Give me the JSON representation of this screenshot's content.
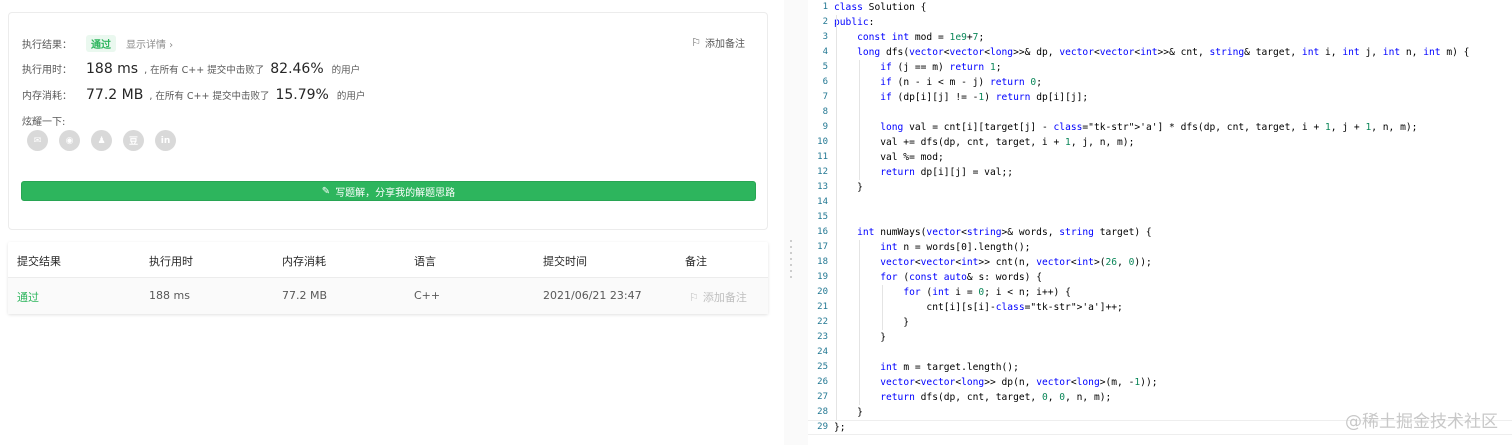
{
  "result": {
    "label": "执行结果：",
    "status": "通过",
    "details_link": "显示详情 ›",
    "add_note": "添加备注",
    "runtime_label": "执行用时：",
    "runtime_value": "188 ms",
    "runtime_text": ", 在所有 C++ 提交中击败了",
    "runtime_pct": "82.46%",
    "runtime_suffix": "的用户",
    "memory_label": "内存消耗：",
    "memory_value": "77.2 MB",
    "memory_text": ", 在所有 C++ 提交中击败了",
    "memory_pct": "15.79%",
    "memory_suffix": "的用户",
    "share_label": "炫耀一下:",
    "share_icons": [
      "wechat-icon",
      "weibo-icon",
      "qq-icon",
      "douban-icon",
      "linkedin-icon"
    ],
    "share_glyphs": [
      "✉",
      "◉",
      "♟",
      "豆",
      "in"
    ],
    "write_button": "写题解，分享我的解题思路",
    "status_color": "#2db55d"
  },
  "submissions": {
    "headers": [
      "提交结果",
      "执行用时",
      "内存消耗",
      "语言",
      "提交时间",
      "备注"
    ],
    "rows": [
      [
        "通过",
        "188 ms",
        "77.2 MB",
        "C++",
        "2021/06/21 23:47",
        "添加备注"
      ]
    ]
  },
  "code": {
    "line_numbers": [
      "1",
      "2",
      "3",
      "4",
      "5",
      "6",
      "7",
      "8",
      "9",
      "10",
      "11",
      "12",
      "13",
      "14",
      "15",
      "16",
      "17",
      "18",
      "19",
      "20",
      "21",
      "22",
      "23",
      "24",
      "25",
      "26",
      "27",
      "28",
      "29"
    ],
    "lines": [
      "class Solution {",
      "public:",
      "    const int mod = 1e9+7;",
      "    long dfs(vector<vector<long>>& dp, vector<vector<int>>& cnt, string& target, int i, int j, int n, int m) {",
      "        if (j == m) return 1;",
      "        if (n - i < m - j) return 0;",
      "        if (dp[i][j] != -1) return dp[i][j];",
      "",
      "        long val = cnt[i][target[j] - 'a'] * dfs(dp, cnt, target, i + 1, j + 1, n, m);",
      "        val += dfs(dp, cnt, target, i + 1, j, n, m);",
      "        val %= mod;",
      "        return dp[i][j] = val;;",
      "    }",
      "",
      "",
      "    int numWays(vector<string>& words, string target) {",
      "        int n = words[0].length();",
      "        vector<vector<int>> cnt(n, vector<int>(26, 0));",
      "        for (const auto& s: words) {",
      "            for (int i = 0; i < n; i++) {",
      "                cnt[i][s[i]-'a']++;",
      "            }",
      "        }",
      "",
      "        int m = target.length();",
      "        vector<vector<long>> dp(n, vector<long>(m, -1));",
      "        return dfs(dp, cnt, target, 0, 0, n, m);",
      "    }",
      "};"
    ]
  },
  "watermark": "@稀土掘金技术社区"
}
